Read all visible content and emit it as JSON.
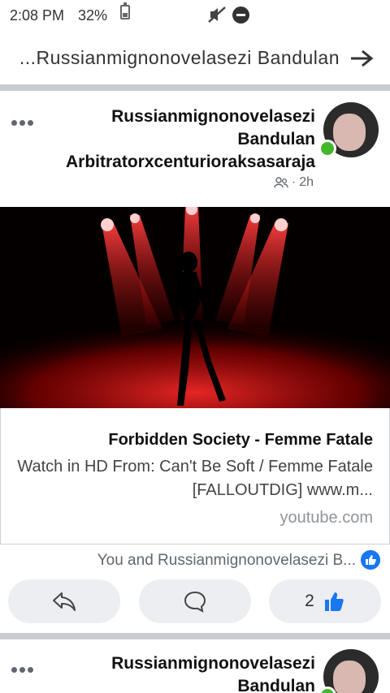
{
  "status_bar": {
    "time": "2:08 PM",
    "battery": "32%",
    "icons": [
      "battery-icon",
      "mute-icon",
      "do-not-disturb-icon"
    ]
  },
  "header": {
    "title": "Russianmignonovelasezi Bandulan...",
    "back_icon": "back-arrow-icon"
  },
  "post": {
    "author_lines": [
      "Russianmignonovelasezi",
      "Bandulan",
      "Arbitratorxcenturioraksasaraja"
    ],
    "time": "2h",
    "audience_icon": "friends-icon",
    "more_icon": "more-icon",
    "link": {
      "title": "Forbidden Society - Femme Fatale",
      "description": "Watch in HD From: Can't Be Soft / Femme Fatale [FALLOUTDIG] www.m...",
      "domain": "youtube.com"
    },
    "reactions_text": "You and Russianmignonovelasezi B...",
    "like_count": "2"
  },
  "next_post": {
    "author_lines": [
      "Russianmignonovelasezi",
      "Bandulan"
    ]
  },
  "colors": {
    "facebook_blue": "#1877f2",
    "online_green": "#42b72a",
    "button_bg": "#eceef1",
    "separator": "#c8ccd0"
  }
}
